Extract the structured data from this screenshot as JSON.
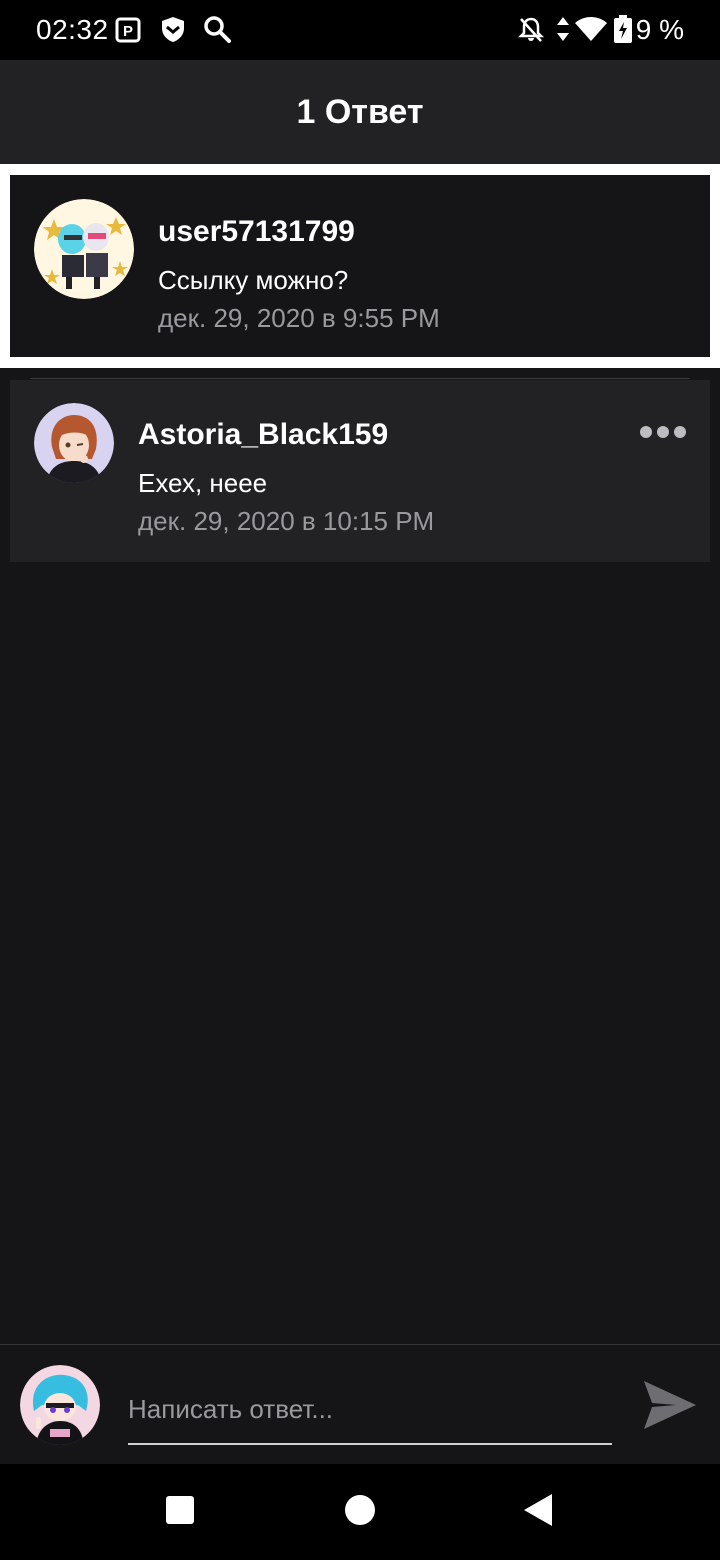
{
  "status": {
    "time": "02:32",
    "battery": "9 %",
    "icons": [
      "parking-icon",
      "shield-icon",
      "search-icon",
      "bell-off-icon",
      "data-arrows-icon",
      "wifi-icon",
      "battery-charging-icon"
    ]
  },
  "header": {
    "title": "1 Ответ"
  },
  "comment": {
    "username": "user57131799",
    "text": "Ссылку можно?",
    "date": "дек. 29, 2020 в 9:55 PM"
  },
  "reply": {
    "username": "Astoria_Black159",
    "text": "Ехех, нееe",
    "date": "дек. 29, 2020 в 10:15 PM"
  },
  "compose": {
    "placeholder": "Написать ответ..."
  },
  "navbar": {
    "icons": [
      "recents-square-icon",
      "home-circle-icon",
      "back-triangle-icon"
    ]
  },
  "colors": {
    "background": "#151417",
    "header": "#222124",
    "secondary_text": "#9a999d",
    "highlight": "#ffffff"
  }
}
